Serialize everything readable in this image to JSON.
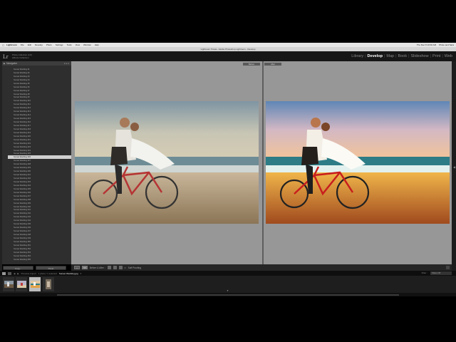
{
  "menubar": {
    "items": [
      "Lightroom",
      "File",
      "Edit",
      "Develop",
      "Photo",
      "Settings",
      "Tools",
      "View",
      "Window",
      "Help"
    ],
    "clock": "Thu Dec 8  10:00 AM",
    "user": "Photo and Sara"
  },
  "window_title": "Lightroom 5 beta - Adobe Photoshop Lightroom - Develop",
  "identity_plate": {
    "line1": "Photo collection (LR)",
    "line2": "Alfredo Collection"
  },
  "modules": [
    {
      "label": "Library",
      "active": false
    },
    {
      "label": "Develop",
      "active": true
    },
    {
      "label": "Map",
      "active": false
    },
    {
      "label": "Book",
      "active": false
    },
    {
      "label": "Slideshow",
      "active": false
    },
    {
      "label": "Print",
      "active": false
    },
    {
      "label": "Web",
      "active": false
    }
  ],
  "left_panel": {
    "title": "Navigator",
    "snapshots": [
      "Sunset Wedding #1",
      "Sunset Wedding #2",
      "Sunset Wedding #3",
      "Sunset Wedding #4",
      "Sunset Wedding #5",
      "Sunset Wedding #6",
      "Sunset Wedding #7",
      "Sunset Wedding #8",
      "Sunset Wedding #9",
      "Sunset Wedding #10",
      "Sunset Wedding #11",
      "Sunset Wedding #12",
      "Sunset Wedding #13",
      "Sunset Wedding #14",
      "Sunset Wedding #15",
      "Sunset Wedding #16",
      "Sunset Wedding #17",
      "Sunset Wedding #18",
      "Sunset Wedding #19",
      "Sunset Wedding #20",
      "Sunset Wedding #21",
      "Sunset Wedding #22",
      "Sunset Wedding #23",
      "Sunset Wedding #24",
      "Sunset Wedding #25",
      "Sunset Wedding #26",
      "Sunset Wedding #27",
      "Sunset Wedding #28",
      "Sunset Wedding #29",
      "Sunset Wedding #30",
      "Sunset Wedding #31",
      "Sunset Wedding #32",
      "Sunset Wedding #33",
      "Sunset Wedding #34",
      "Sunset Wedding #35",
      "Sunset Wedding #36",
      "Sunset Wedding #37",
      "Sunset Wedding #38",
      "Sunset Wedding #39",
      "Sunset Wedding #40",
      "Sunset Wedding #41",
      "Sunset Wedding #42",
      "Sunset Wedding #43",
      "Sunset Wedding #44",
      "Sunset Wedding #45",
      "Sunset Wedding #46",
      "Sunset Wedding #47",
      "Sunset Wedding #48",
      "Sunset Wedding #49",
      "Sunset Wedding #50",
      "Sunset Wedding #51",
      "Sunset Wedding #52",
      "Sunset Wedding #53",
      "Sunset Wedding #54",
      "Sunset Wedding #55"
    ],
    "selected_index": 25,
    "copy_label": "Copy...",
    "paste_label": "Paste"
  },
  "compare": {
    "before_label": "Before",
    "after_label": "After"
  },
  "toolbar": {
    "mode_label": "Before & After :",
    "soft_proofing_label": "Soft Proofing"
  },
  "filmstrip": {
    "source_prefix": "Previous Import",
    "source_detail": "1 photo / 1 selected",
    "filename": "Sunset Wedding.jpg",
    "filter_label": "Filter :",
    "filter_value": "Filters Off",
    "thumb_count": 4,
    "selected_thumb": 2
  },
  "colors": {
    "panel_bg": "#2e2e2e",
    "canvas_bg": "#979797",
    "active_module": "#ffffff",
    "inactive_module": "#8a8a8a"
  }
}
